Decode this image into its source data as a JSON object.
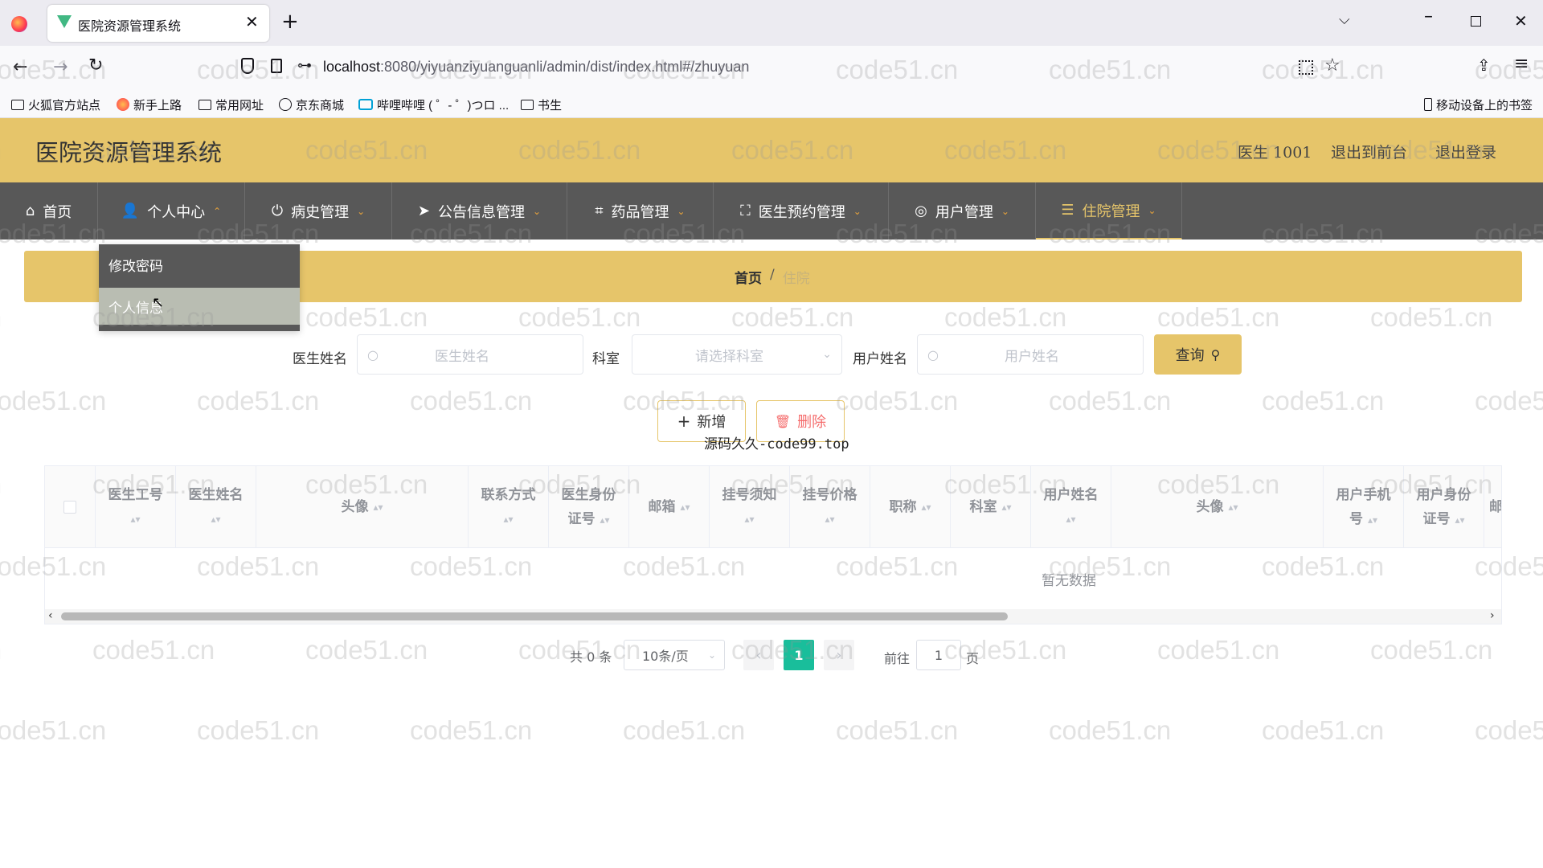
{
  "browser": {
    "tab_title": "医院资源管理系统",
    "url_host": "localhost",
    "url_rest": ":8080/yiyuanziyuanguanli/admin/dist/index.html#/zhuyuan",
    "bookmarks": [
      "火狐官方站点",
      "新手上路",
      "常用网址",
      "京东商城",
      "哔哩哔哩 ( ゜- ゜)つロ ...",
      "书生"
    ],
    "mobile_bookmarks": "移动设备上的书签"
  },
  "app": {
    "title": "医院资源管理系统",
    "user": "医生 1001",
    "back_to_front": "退出到前台",
    "logout": "退出登录"
  },
  "nav": [
    {
      "label": "首页"
    },
    {
      "label": "个人中心"
    },
    {
      "label": "病史管理"
    },
    {
      "label": "公告信息管理"
    },
    {
      "label": "药品管理"
    },
    {
      "label": "医生预约管理"
    },
    {
      "label": "用户管理"
    },
    {
      "label": "住院管理"
    }
  ],
  "dropdown": {
    "change_password": "修改密码",
    "personal_info": "个人信息"
  },
  "breadcrumb": {
    "home": "首页",
    "sep": "/",
    "current": "住院"
  },
  "search": {
    "doctor_name_label": "医生姓名",
    "doctor_name_placeholder": "医生姓名",
    "dept_label": "科室",
    "dept_placeholder": "请选择科室",
    "user_name_label": "用户姓名",
    "user_name_placeholder": "用户姓名",
    "query_label": "查询"
  },
  "actions": {
    "add_label": "新增",
    "delete_label": "删除"
  },
  "overlay_text": "源码久久-code99.top",
  "table": {
    "headers": [
      {
        "line1": "医生工号",
        "line2": ""
      },
      {
        "line1": "医生姓名",
        "line2": ""
      },
      {
        "line1": "头像",
        "line2": ""
      },
      {
        "line1": "联系方式",
        "line2": ""
      },
      {
        "line1": "医生身份",
        "line2": "证号"
      },
      {
        "line1": "邮箱",
        "line2": ""
      },
      {
        "line1": "挂号须知",
        "line2": ""
      },
      {
        "line1": "挂号价格",
        "line2": ""
      },
      {
        "line1": "职称",
        "line2": ""
      },
      {
        "line1": "科室",
        "line2": ""
      },
      {
        "line1": "用户姓名",
        "line2": ""
      },
      {
        "line1": "头像",
        "line2": ""
      },
      {
        "line1": "用户手机",
        "line2": "号"
      },
      {
        "line1": "用户身份",
        "line2": "证号"
      },
      {
        "line1": "邮箱",
        "line2": ""
      }
    ],
    "empty_text": "暂无数据"
  },
  "pagination": {
    "total": "共 0 条",
    "page_size": "10条/页",
    "current_page": "1",
    "goto_label": "前往",
    "goto_value": "1",
    "page_unit": "页"
  },
  "watermark": "code51.cn",
  "colors": {
    "accent": "#e6c56a",
    "nav_bg": "#585858",
    "page_active": "#19be9b",
    "danger": "#f56c6c"
  }
}
